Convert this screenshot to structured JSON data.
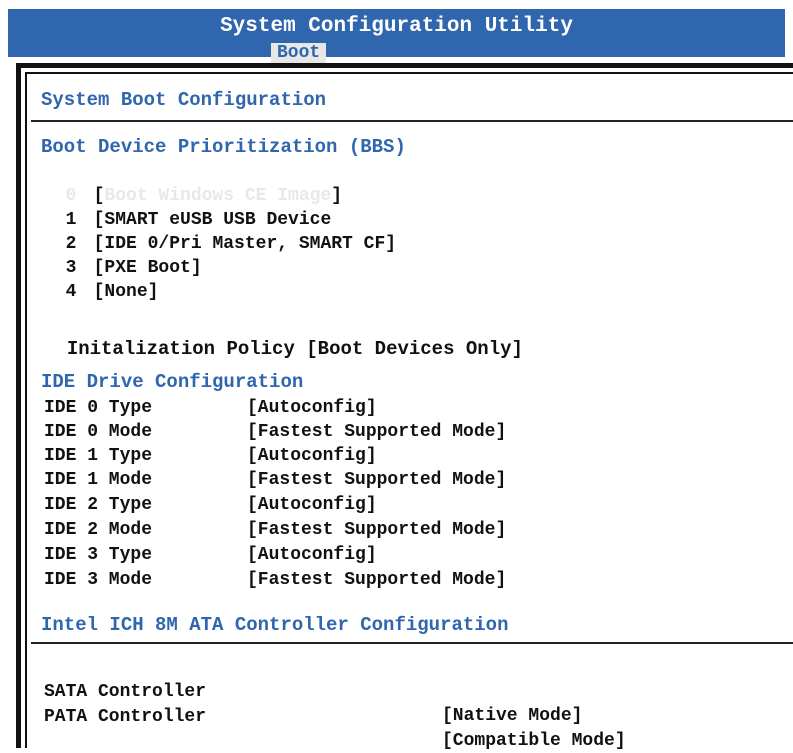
{
  "header": {
    "title": "System Configuration Utility",
    "active_tab": "Boot"
  },
  "system_boot": {
    "title": "System Boot Configuration"
  },
  "boot_priority": {
    "title": "Boot Device Prioritization (BBS)",
    "items": [
      {
        "index": "0",
        "open": "[",
        "label": "Boot Windows CE Image",
        "close": "]"
      },
      {
        "index": "1",
        "open": "[",
        "label": "SMART eUSB USB Device",
        "close": ""
      },
      {
        "index": "2",
        "open": "[",
        "label": "IDE 0/Pri Master, SMART CF",
        "close": "]"
      },
      {
        "index": "3",
        "open": "[",
        "label": "PXE Boot",
        "close": "]"
      },
      {
        "index": "4",
        "open": "[",
        "label": "None",
        "close": "]"
      }
    ]
  },
  "init_policy": {
    "label": "Initalization Policy",
    "value": "[Boot Devices Only]"
  },
  "ide_config": {
    "title": "IDE Drive Configuration",
    "rows": [
      {
        "label": "IDE 0 Type",
        "value": "[Autoconfig]"
      },
      {
        "label": "IDE 0 Mode",
        "value": "[Fastest Supported Mode]"
      },
      {
        "label": "IDE 1 Type",
        "value": "[Autoconfig]"
      },
      {
        "label": "IDE 1 Mode",
        "value": "[Fastest Supported Mode]"
      },
      {
        "label": "IDE 2 Type",
        "value": "[Autoconfig]"
      },
      {
        "label": "IDE 2 Mode",
        "value": "[Fastest Supported Mode]"
      },
      {
        "label": "IDE 3 Type",
        "value": "[Autoconfig]"
      },
      {
        "label": "IDE 3 Mode",
        "value": "[Fastest Supported Mode]"
      }
    ]
  },
  "ata_controller": {
    "title": "Intel ICH 8M ATA Controller Configuration",
    "rows": [
      {
        "label": "SATA Controller",
        "value": "[Native Mode]"
      },
      {
        "label": "PATA Controller",
        "value": "[Compatible Mode]"
      }
    ]
  },
  "colors": {
    "header_bg": "#2f66ad",
    "section_title": "#2f66ad",
    "selected_text": "#e8e8e8"
  }
}
